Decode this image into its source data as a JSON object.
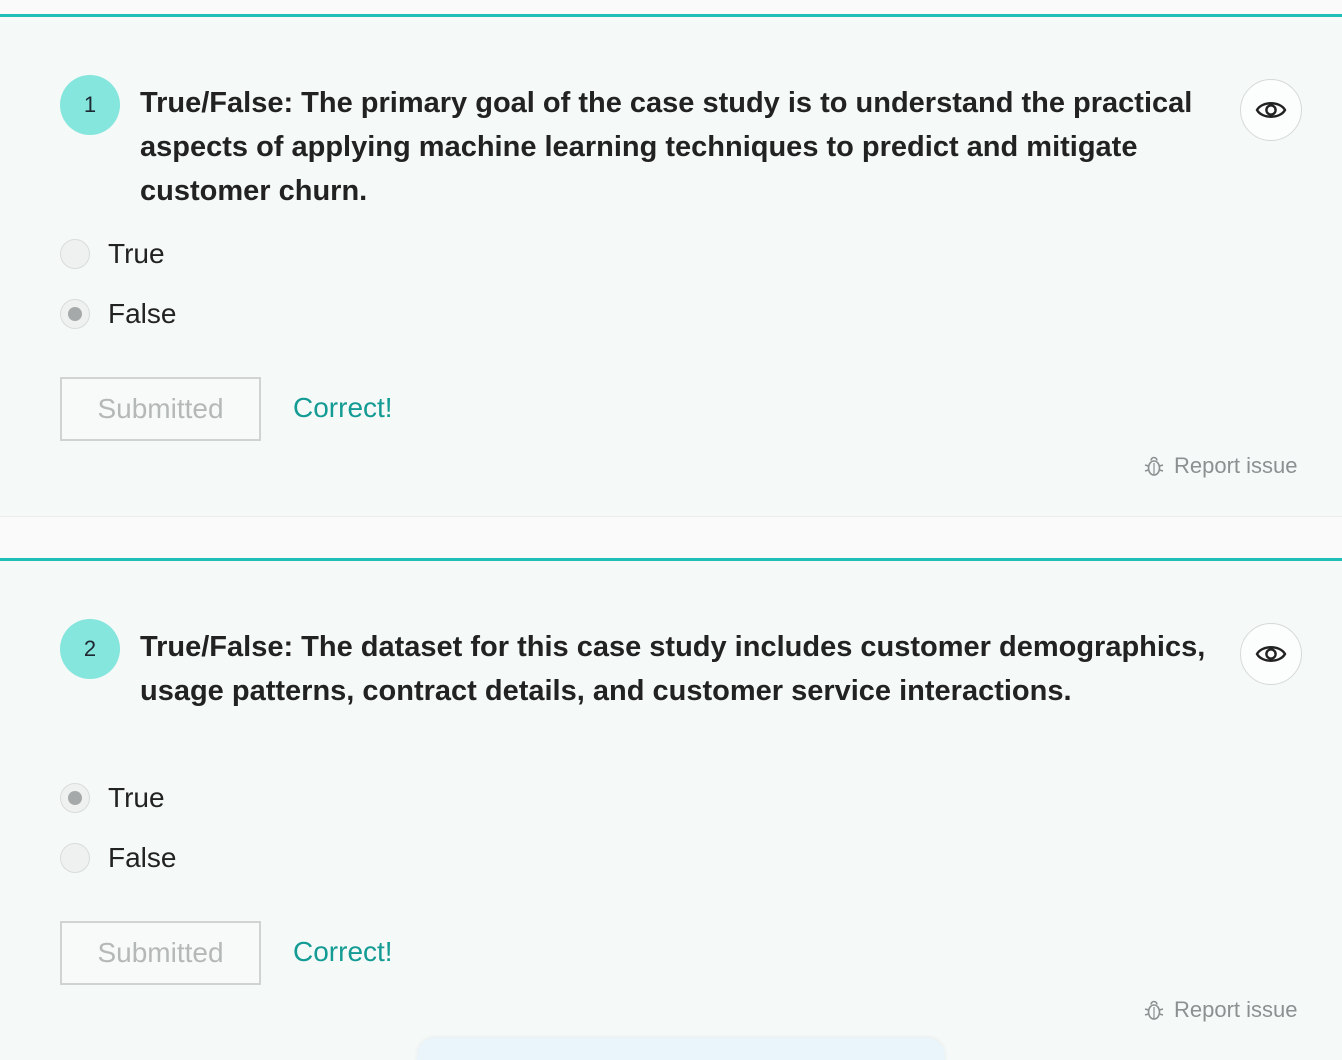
{
  "questions": [
    {
      "number": "1",
      "text": "True/False: The primary goal of the case study is to understand the practical aspects of applying machine learning techniques to predict and mitigate customer churn.",
      "options": [
        {
          "label": "True",
          "selected": false
        },
        {
          "label": "False",
          "selected": true
        }
      ],
      "submit_label": "Submitted",
      "feedback": "Correct!",
      "report_label": "Report issue",
      "view_icon": "eye-icon"
    },
    {
      "number": "2",
      "text": "True/False: The dataset for this case study includes customer demographics, usage patterns, contract details, and customer service interactions.",
      "options": [
        {
          "label": "True",
          "selected": true
        },
        {
          "label": "False",
          "selected": false
        }
      ],
      "submit_label": "Submitted",
      "feedback": "Correct!",
      "report_label": "Report issue",
      "view_icon": "eye-icon"
    }
  ],
  "colors": {
    "accent": "#1fbfb8",
    "badge": "#84e6dc",
    "feedback": "#139b94",
    "card_bg": "#f5f9f8"
  }
}
